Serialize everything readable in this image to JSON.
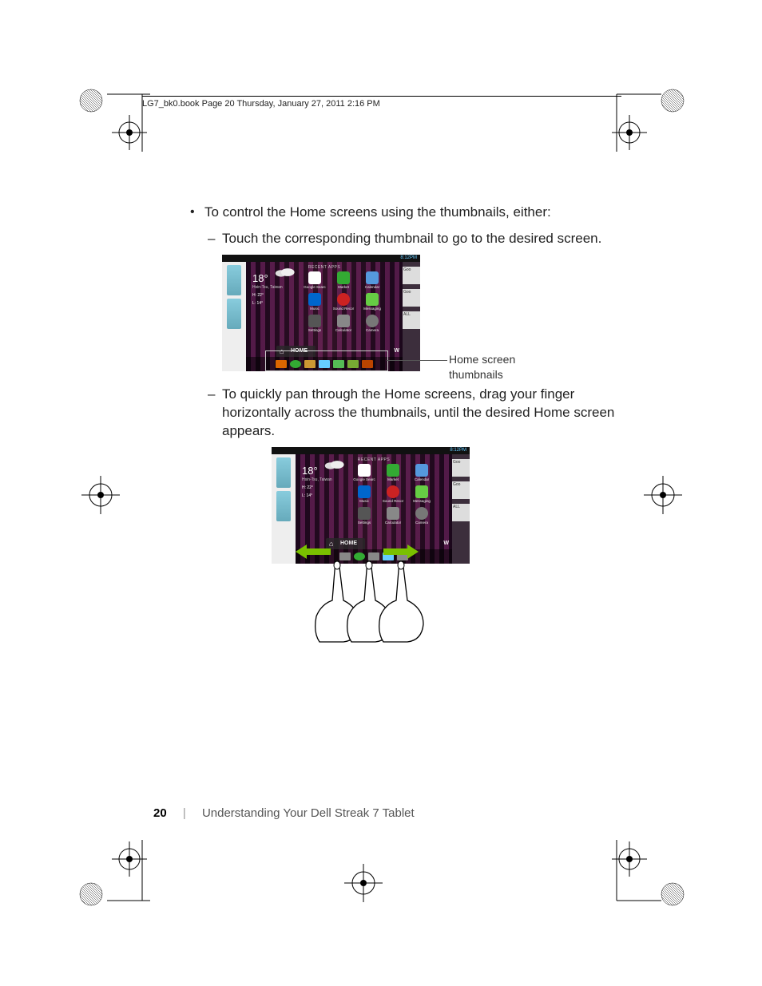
{
  "header": "LG7_bk0.book  Page 20  Thursday, January 27, 2011  2:16 PM",
  "content": {
    "bullet1": "To control the Home screens using the thumbnails, either:",
    "sub1": "Touch the corresponding thumbnail to go to the desired screen.",
    "sub2": "To quickly pan through the Home screens, drag your finger horizontally across the thumbnails, until the desired Home screen appears."
  },
  "callout": {
    "line1": "Home screen",
    "line2": "thumbnails"
  },
  "screenshot": {
    "status_time": "8:12PM",
    "recent": "RECENT APPS",
    "weather": {
      "temp": "18°",
      "location": "Hsin-Tsu, Taiwan",
      "high": "H:  22°",
      "low": "L:  14°"
    },
    "apps": {
      "r1": [
        {
          "name": "google-search-icon",
          "label": "Google Searc"
        },
        {
          "name": "market-icon",
          "label": "Market"
        },
        {
          "name": "calendar-icon",
          "label": "Calendar"
        }
      ],
      "r2": [
        {
          "name": "music-icon",
          "label": "Music"
        },
        {
          "name": "sound-recorder-icon",
          "label": "Sound Recor"
        },
        {
          "name": "messaging-icon",
          "label": "Messaging"
        }
      ],
      "r3": [
        {
          "name": "settings-icon",
          "label": "Settings"
        },
        {
          "name": "calculator-icon",
          "label": "Calculator"
        },
        {
          "name": "camera-icon",
          "label": "Camera"
        }
      ]
    },
    "home_label": "HOME",
    "w_label": "W",
    "right_cards": [
      "Goo",
      "Goo",
      "ALL"
    ]
  },
  "footer": {
    "page": "20",
    "section": "Understanding Your Dell Streak 7 Tablet"
  }
}
